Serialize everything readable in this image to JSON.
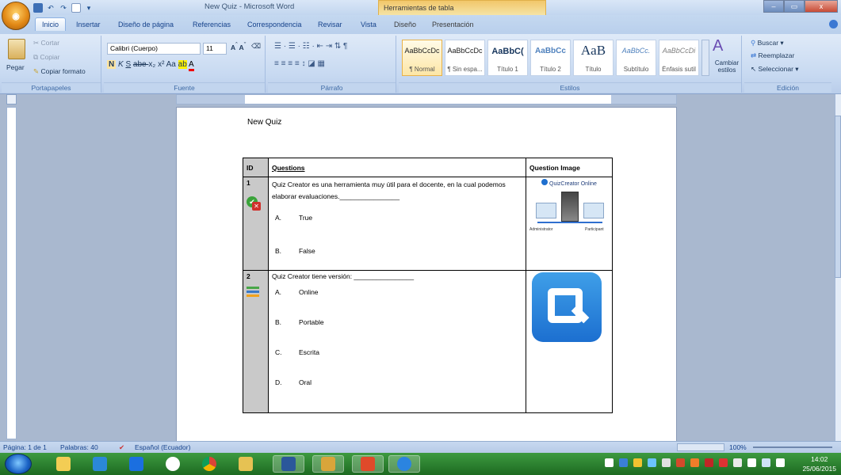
{
  "window": {
    "title": "New Quiz - Microsoft Word",
    "contextual_group": "Herramientas de tabla"
  },
  "tabs": [
    "Inicio",
    "Insertar",
    "Diseño de página",
    "Referencias",
    "Correspondencia",
    "Revisar",
    "Vista",
    "Diseño",
    "Presentación"
  ],
  "ribbon": {
    "portapapeles": {
      "paste": "Pegar",
      "cut": "Cortar",
      "copy": "Copiar",
      "format_painter": "Copiar formato",
      "label": "Portapapeles"
    },
    "fuente": {
      "font": "Calibri (Cuerpo)",
      "size": "11",
      "label": "Fuente"
    },
    "parrafo": {
      "label": "Párrafo"
    },
    "estilos": {
      "label": "Estilos",
      "items": [
        {
          "preview": "AaBbCcDc",
          "name": "¶ Normal"
        },
        {
          "preview": "AaBbCcDc",
          "name": "¶ Sin espa..."
        },
        {
          "preview": "AaBbC(",
          "name": "Título 1"
        },
        {
          "preview": "AaBbCc",
          "name": "Título 2"
        },
        {
          "preview": "AaB",
          "name": "Título"
        },
        {
          "preview": "AaBbCc.",
          "name": "Subtítulo"
        },
        {
          "preview": "AaBbCcDi",
          "name": "Énfasis sutil"
        }
      ],
      "change_styles": "Cambiar estilos"
    },
    "edicion": {
      "find": "Buscar",
      "replace": "Reemplazar",
      "select": "Seleccionar",
      "label": "Edición"
    }
  },
  "document": {
    "title": "New Quiz",
    "table_headers": {
      "id": "ID",
      "questions": "Questions",
      "image": "Question Image"
    },
    "questions": [
      {
        "id": "1",
        "text": "Quiz Creator es una herramienta muy útil para el docente, en la cual podemos elaborar evaluaciones.________________",
        "options": [
          {
            "letter": "A.",
            "text": "True"
          },
          {
            "letter": "B.",
            "text": "False"
          }
        ],
        "image_caption": "QuizCreator Online",
        "image_labels": [
          "Administrator",
          "Participant"
        ]
      },
      {
        "id": "2",
        "text": "Quiz Creator tiene versión: ________________",
        "options": [
          {
            "letter": "A.",
            "text": "Online"
          },
          {
            "letter": "B.",
            "text": "Portable"
          },
          {
            "letter": "C.",
            "text": "Escrita"
          },
          {
            "letter": "D.",
            "text": "Oral"
          }
        ]
      }
    ]
  },
  "statusbar": {
    "page": "Página: 1 de 1",
    "words": "Palabras: 40",
    "language": "Español (Ecuador)",
    "zoom": "100%"
  },
  "taskbar": {
    "time": "14:02",
    "date": "25/06/2015"
  }
}
